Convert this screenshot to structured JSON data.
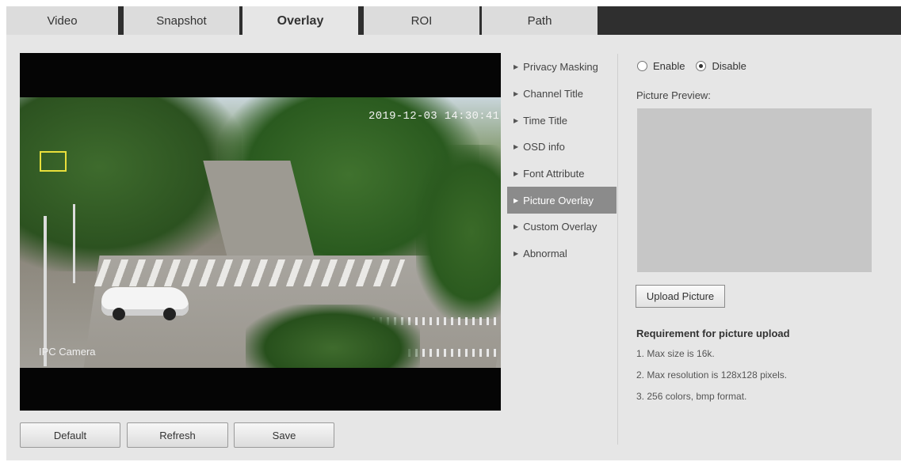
{
  "tabs": [
    {
      "label": "Video",
      "active": false
    },
    {
      "label": "Snapshot",
      "active": false
    },
    {
      "label": "Overlay",
      "active": true
    },
    {
      "label": "ROI",
      "active": false
    },
    {
      "label": "Path",
      "active": false
    }
  ],
  "video": {
    "osd_time": "2019-12-03 14:30:41",
    "osd_channel": "IPC Camera"
  },
  "buttons": {
    "default": "Default",
    "refresh": "Refresh",
    "save": "Save"
  },
  "menu": {
    "items": [
      {
        "label": "Privacy Masking",
        "active": false
      },
      {
        "label": "Channel Title",
        "active": false
      },
      {
        "label": "Time Title",
        "active": false
      },
      {
        "label": "OSD info",
        "active": false
      },
      {
        "label": "Font Attribute",
        "active": false
      },
      {
        "label": "Picture Overlay",
        "active": true
      },
      {
        "label": "Custom Overlay",
        "active": false
      },
      {
        "label": "Abnormal",
        "active": false
      }
    ]
  },
  "picture_overlay": {
    "enable_label": "Enable",
    "disable_label": "Disable",
    "selected": "Disable",
    "preview_label": "Picture Preview:",
    "upload_button": "Upload Picture",
    "requirement_title": "Requirement for picture upload",
    "requirements": [
      "1. Max size is 16k.",
      "2. Max resolution is 128x128 pixels.",
      "3. 256 colors, bmp format."
    ]
  },
  "colors": {
    "tabbar_bg": "#2f2f2f",
    "panel_bg": "#e6e6e6",
    "menu_active_bg": "#8b8b8b",
    "preview_bg": "#c6c6c6"
  }
}
